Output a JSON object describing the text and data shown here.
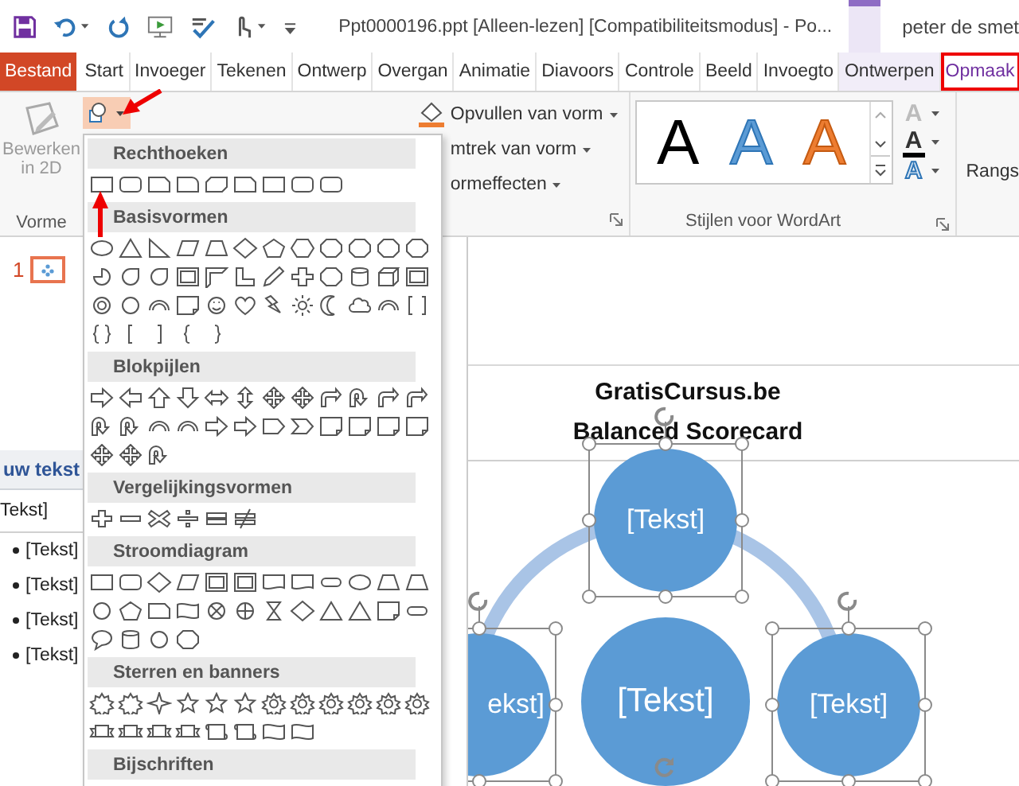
{
  "title_bar": {
    "title": "Ppt0000196.ppt [Alleen-lezen] [Compatibiliteitsmodus] - Po...",
    "user": "peter de smet"
  },
  "tabs": [
    {
      "label": "Bestand",
      "kind": "file",
      "contextual": false,
      "selected": false
    },
    {
      "label": "Start",
      "kind": "tab",
      "contextual": false,
      "selected": false
    },
    {
      "label": "Invoeger",
      "kind": "tab",
      "contextual": false,
      "selected": false
    },
    {
      "label": "Tekenen",
      "kind": "tab",
      "contextual": false,
      "selected": false
    },
    {
      "label": "Ontwerp",
      "kind": "tab",
      "contextual": false,
      "selected": false
    },
    {
      "label": "Overgan",
      "kind": "tab",
      "contextual": false,
      "selected": false
    },
    {
      "label": "Animatie",
      "kind": "tab",
      "contextual": false,
      "selected": false
    },
    {
      "label": "Diavoors",
      "kind": "tab",
      "contextual": false,
      "selected": false
    },
    {
      "label": "Controle",
      "kind": "tab",
      "contextual": false,
      "selected": false
    },
    {
      "label": "Beeld",
      "kind": "tab",
      "contextual": false,
      "selected": false
    },
    {
      "label": "Invoegto",
      "kind": "tab",
      "contextual": false,
      "selected": false
    },
    {
      "label": "Ontwerpen",
      "kind": "tab",
      "contextual": true,
      "selected": false
    },
    {
      "label": "Opmaak",
      "kind": "tab",
      "contextual": true,
      "selected": true
    }
  ],
  "ribbon": {
    "edit_shape": {
      "label": "Bewerken in 2D",
      "disabled": true
    },
    "shapes_group_label": "Vorme",
    "shape_commands": [
      {
        "label": "Opvullen van vorm"
      },
      {
        "label": "mtrek van vorm"
      },
      {
        "label": "ormeffecten"
      }
    ],
    "wordart_styles": [
      {
        "letter": "A",
        "color": "#000000"
      },
      {
        "letter": "A",
        "color": "#5b9bd5"
      },
      {
        "letter": "A",
        "color": "#ed7d31"
      }
    ],
    "wordart_group_label": "Stijlen voor WordArt",
    "text_commands": [
      {
        "letter": "A",
        "kind": "fill",
        "disabled": true
      },
      {
        "letter": "A",
        "kind": "outline",
        "disabled": false
      },
      {
        "letter": "A",
        "kind": "effects",
        "disabled": false
      }
    ],
    "arrange_label": "Rangs"
  },
  "shapes_menu": {
    "sections": [
      {
        "title": "Rechthoeken"
      },
      {
        "title": "Basisvormen"
      },
      {
        "title": "Blokpijlen"
      },
      {
        "title": "Vergelijkingsvormen"
      },
      {
        "title": "Stroomdiagram"
      },
      {
        "title": "Sterren en banners"
      },
      {
        "title": "Bijschriften"
      }
    ]
  },
  "thumbnails": [
    {
      "number": "1",
      "selected": true
    }
  ],
  "text_pane": {
    "title": "uw tekst",
    "first_line": "Tekst]",
    "bullets": [
      "[Tekst]",
      "[Tekst]",
      "[Tekst]",
      "[Tekst]"
    ]
  },
  "slide": {
    "title_lines": [
      "GratisCursus.be",
      "Balanced Scorecard"
    ],
    "nodes": [
      {
        "text": "[Tekst]",
        "kind": "top",
        "selected": true
      },
      {
        "text": "ekst]",
        "kind": "left",
        "selected": true
      },
      {
        "text": "[Tekst]",
        "kind": "center",
        "selected": false
      },
      {
        "text": "[Tekst]",
        "kind": "right",
        "selected": true
      }
    ]
  }
}
